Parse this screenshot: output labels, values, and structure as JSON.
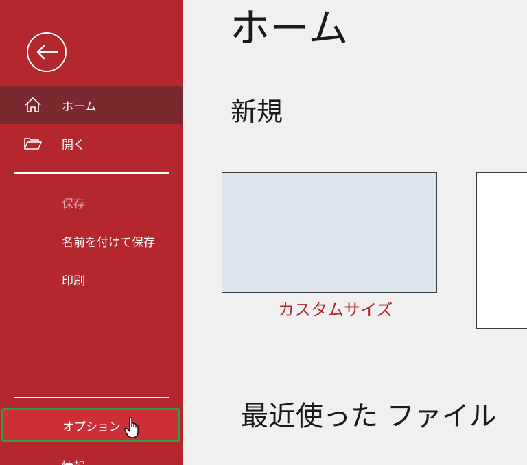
{
  "sidebar": {
    "items": [
      {
        "label": "ホーム",
        "icon": "home-icon",
        "selected": true
      },
      {
        "label": "開く",
        "icon": "folder-open-icon"
      },
      {
        "label": "保存",
        "disabled": true
      },
      {
        "label": "名前を付けて保存"
      },
      {
        "label": "印刷"
      },
      {
        "label": "オプション",
        "highlighted": true
      },
      {
        "label": "情報"
      }
    ],
    "back_icon": "back-arrow-icon"
  },
  "main": {
    "title": "ホーム",
    "new_section_title": "新規",
    "templates": [
      {
        "label": "カスタムサイズ"
      }
    ],
    "recent_section_title": "最近使った ファイル"
  },
  "colors": {
    "sidebar_bg": "#b4272f",
    "sidebar_selected": "#7a2a2e",
    "accent_text": "#b4272f",
    "options_highlight_border": "#2e9e3e",
    "main_bg": "#f0f0f0",
    "template_thumb": "#dce4ef"
  }
}
